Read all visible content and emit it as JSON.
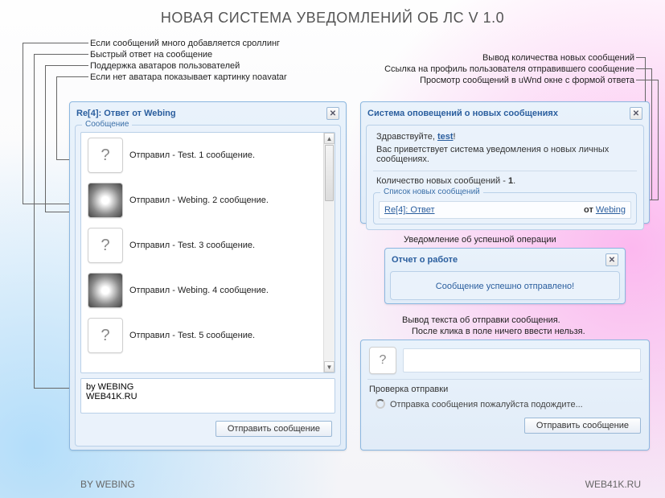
{
  "page_title": "НОВАЯ СИСТЕМА УВЕДОМЛЕНИЙ ОБ ЛС V 1.0",
  "annotations": {
    "a1": "Если сообщений много добавляется сроллинг",
    "a2": "Быстрый ответ на сообщение",
    "a3": "Поддержка аватаров пользователей",
    "a4": "Если нет аватара показывает картинку noavatar",
    "r1": "Вывод количества новых сообщений",
    "r2": "Ссылка на профиль пользователя отправившего сообщение",
    "r3": "Просмотр сообщений в uWnd окне с формой ответа",
    "c1": "Уведомление об успешной операции",
    "c2": "Вывод текста об отправки сообщения.",
    "c3": "После клика в поле ничего ввести нельзя."
  },
  "left_panel": {
    "title": "Re[4]: Ответ от Webing",
    "fieldset_label": "Сообщение",
    "messages": [
      {
        "text": "Отправил - Test. 1 сообщение.",
        "avatar": "none"
      },
      {
        "text": "Отправил - Webing. 2 сообщение.",
        "avatar": "img"
      },
      {
        "text": "Отправил - Test. 3 сообщение.",
        "avatar": "none"
      },
      {
        "text": "Отправил - Webing. 4 сообщение.",
        "avatar": "img"
      },
      {
        "text": "Отправил - Test. 5 сообщение.",
        "avatar": "none"
      }
    ],
    "compose_value": "by WEBING\nWEB41K.RU",
    "send_btn": "Отправить сообщение"
  },
  "notify_panel": {
    "title": "Система оповещений о новых сообщениях",
    "greeting_pre": "Здравствуйте, ",
    "greeting_user": "test",
    "greeting_post": "!",
    "welcome": "Вас приветствует система уведомления о новых личных сообщениях.",
    "count_label": "Количество новых сообщений - ",
    "count_value": "1",
    "list_label": "Список новых сообщений",
    "item_subject": "Re[4]: Ответ",
    "item_from_label": "от ",
    "item_from_user": "Webing"
  },
  "report_panel": {
    "title": "Отчет о работе",
    "body": "Сообщение успешно отправлено!"
  },
  "sending_panel": {
    "placeholder_avatar": "?",
    "check_label": "Проверка отправки",
    "progress_text": "Отправка сообщения пожалуйста подождите...",
    "send_btn": "Отправить сообщение"
  },
  "footer": {
    "left": "BY WEBING",
    "right": "WEB41K.RU"
  }
}
